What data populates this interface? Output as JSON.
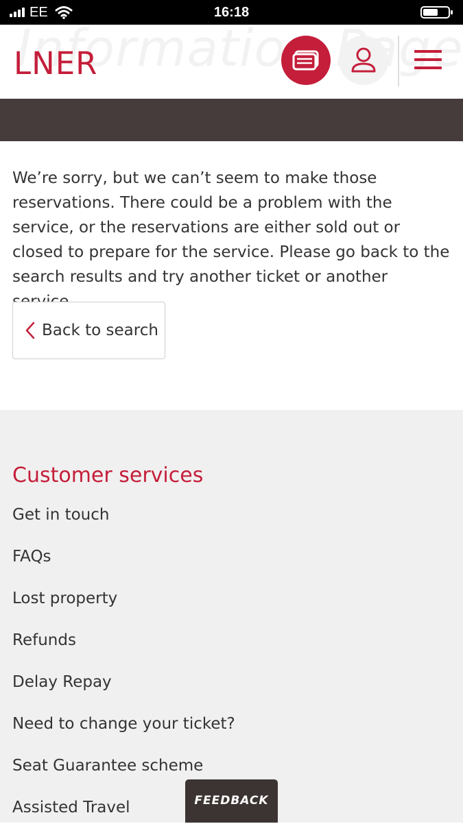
{
  "status_bar": {
    "carrier": "EE",
    "time": "16:18",
    "battery_level_percent": 60
  },
  "header": {
    "watermark_text": "Information Page",
    "logo_text": "LNER",
    "icons": [
      "ticket-icon",
      "user-icon",
      "menu-icon"
    ],
    "brand_color": "#c41e3a"
  },
  "content": {
    "message": "We’re sorry, but we can’t seem to make those reservations. There could be a problem with the service, or the reservations are either sold out or closed to prepare for the service. Please go back to the search results and try another ticket or another service.",
    "back_button_label": "Back to search"
  },
  "footer": {
    "title": "Customer services",
    "links": [
      "Get in touch",
      "FAQs",
      "Lost property",
      "Refunds",
      "Delay Repay",
      "Need to change your ticket?",
      "Seat Guarantee scheme",
      "Assisted Travel"
    ]
  },
  "feedback_label": "FEEDBACK",
  "colors": {
    "banner": "#453c3b",
    "footer_bg": "#f1f0f0",
    "feedback_bg": "#3c3433"
  }
}
